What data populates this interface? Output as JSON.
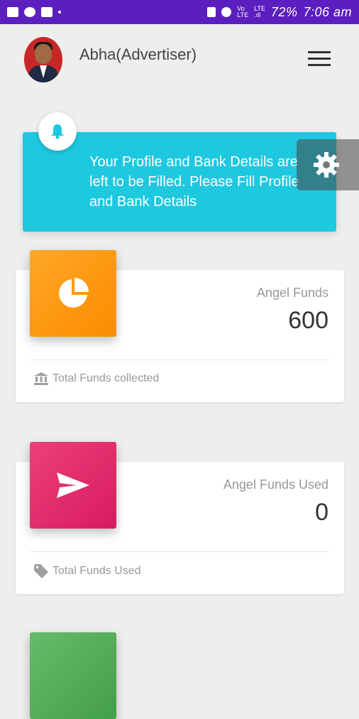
{
  "status_bar": {
    "battery": "72%",
    "time": "7:06 am",
    "left_icons": [
      "image-icon",
      "whatsapp-icon",
      "mail-icon"
    ],
    "right_icons": [
      "lock-icon",
      "alarm-icon",
      "volte-icon",
      "signal-icon"
    ],
    "background": "#5b1fbf"
  },
  "header": {
    "username": "Abha(Advertiser)",
    "menu_icon": "hamburger-menu-icon"
  },
  "notice": {
    "message": "Your Profile and Bank Details are left to be Filled. Please Fill Profile and Bank Details",
    "icon": "bell-icon",
    "color": "#1ec8df"
  },
  "settings": {
    "icon": "gear-icon"
  },
  "cards": [
    {
      "title": "Angel Funds",
      "value": "600",
      "footer": "Total Funds collected",
      "tile_icon": "pie-chart-icon",
      "footer_icon": "bank-icon",
      "color": "#fb8c00"
    },
    {
      "title": "Angel Funds Used",
      "value": "0",
      "footer": "Total Funds Used",
      "tile_icon": "send-icon",
      "footer_icon": "tag-icon",
      "color": "#d81b60"
    }
  ],
  "third_tile": {
    "color": "#43a047"
  }
}
